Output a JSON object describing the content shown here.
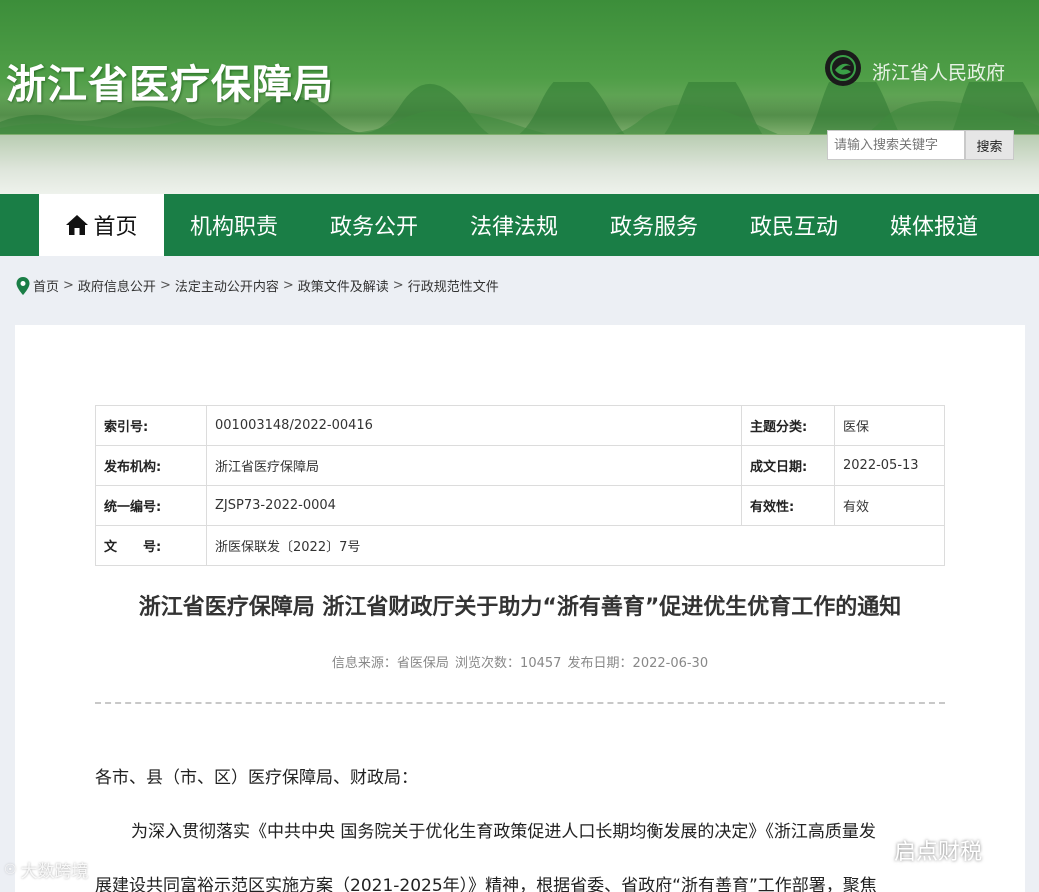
{
  "header": {
    "site_title": "浙江省医疗保障局",
    "gov_link": "浙江省人民政府",
    "search_placeholder": "请输入搜索关键字",
    "search_button": "搜索"
  },
  "nav": {
    "items": [
      {
        "label": "首页",
        "active": true
      },
      {
        "label": "机构职责"
      },
      {
        "label": "政务公开"
      },
      {
        "label": "法律法规"
      },
      {
        "label": "政务服务"
      },
      {
        "label": "政民互动"
      },
      {
        "label": "媒体报道"
      }
    ]
  },
  "breadcrumb": {
    "items": [
      "首页",
      "政府信息公开",
      "法定主动公开内容",
      "政策文件及解读",
      "行政规范性文件"
    ],
    "separator": ">"
  },
  "meta": {
    "rows": [
      {
        "k1": "索引号:",
        "v1": "001003148/2022-00416",
        "k2": "主题分类:",
        "v2": "医保"
      },
      {
        "k1": "发布机构:",
        "v1": "浙江省医疗保障局",
        "k2": "成文日期:",
        "v2": "2022-05-13"
      },
      {
        "k1": "统一编号:",
        "v1": "ZJSP73-2022-0004",
        "k2": "有效性:",
        "v2": "有效"
      },
      {
        "k1": "文　　号:",
        "v1": "浙医保联发〔2022〕7号"
      }
    ]
  },
  "article": {
    "title": "浙江省医疗保障局 浙江省财政厅关于助力“浙有善育”促进优生优育工作的通知",
    "source": "信息来源：省医保局",
    "views": "浏览次数：10457",
    "date": "发布日期：2022-06-30",
    "paragraphs": [
      "各市、县（市、区）医疗保障局、财政局：",
      "为深入贯彻落实《中共中央 国务院关于优化生育政策促进人口长期均衡发展的决定》《浙江高质量发",
      "展建设共同富裕示范区实施方案（2021-2025年）》精神，根据省委、省政府“浙有善育”工作部署，聚焦"
    ]
  },
  "watermarks": {
    "left": "大数跨境",
    "right": "启点财税"
  },
  "colors": {
    "nav_bg": "#1a7e46",
    "banner_green": "#4f9e47",
    "page_bg": "#eceff4"
  }
}
